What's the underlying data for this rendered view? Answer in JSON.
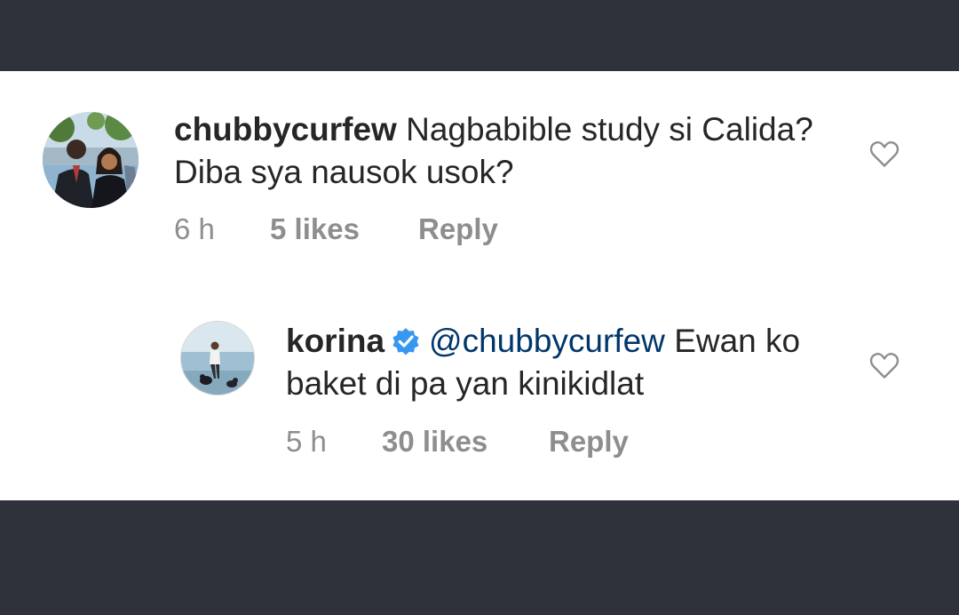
{
  "comments": [
    {
      "username": "chubbycurfew",
      "text": "Nagbabible study si Calida? Diba sya nausok usok?",
      "time": "6 h",
      "likes": "5 likes",
      "reply": "Reply",
      "avatar_icon": "user-avatar-photo",
      "like_icon": "heart-outline-icon"
    },
    {
      "username": "korina",
      "verified": true,
      "verified_icon": "verified-badge-icon",
      "mention": "@chubbycurfew",
      "text": "Ewan ko baket di pa yan kinikidlat",
      "time": "5 h",
      "likes": "30 likes",
      "reply": "Reply",
      "avatar_icon": "user-avatar-photo",
      "like_icon": "heart-outline-icon"
    }
  ],
  "colors": {
    "background_bar": "#2f323a",
    "panel": "#ffffff",
    "text": "#262626",
    "mention": "#00376b",
    "meta": "#8e8e8e",
    "verified": "#3897f0"
  }
}
